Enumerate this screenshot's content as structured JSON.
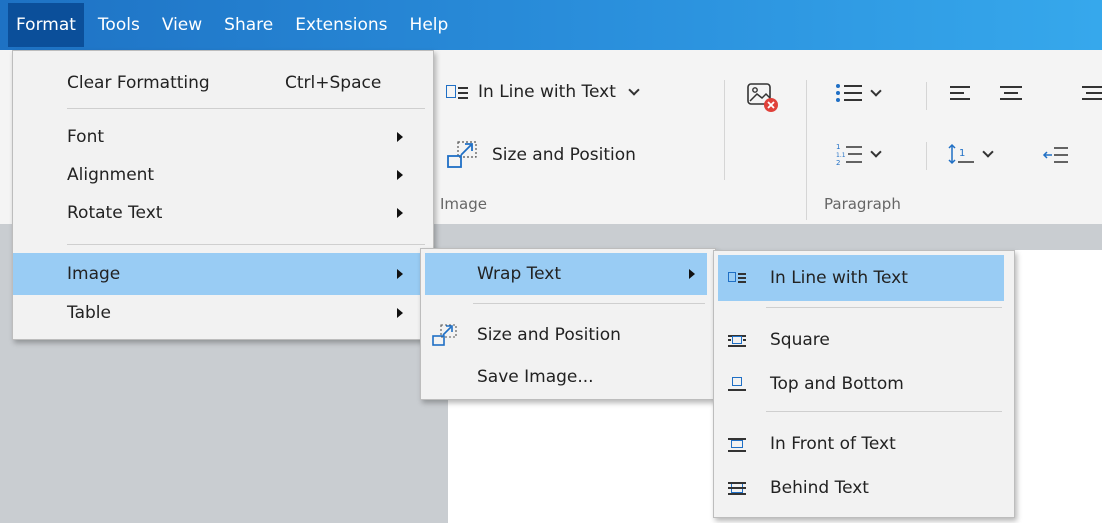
{
  "menubar": {
    "items": [
      "Format",
      "Tools",
      "View",
      "Share",
      "Extensions",
      "Help"
    ],
    "active": "Format"
  },
  "ribbon": {
    "wrap_label": "In Line with Text",
    "size_label": "Size and Position",
    "image_group": "Image",
    "paragraph_group": "Paragraph"
  },
  "format_menu": {
    "clear_formatting": "Clear Formatting",
    "clear_shortcut": "Ctrl+Space",
    "font": "Font",
    "alignment": "Alignment",
    "rotate_text": "Rotate Text",
    "image": "Image",
    "table": "Table"
  },
  "image_menu": {
    "wrap_text": "Wrap Text",
    "size_position": "Size and Position",
    "save_image": "Save Image..."
  },
  "wrap_menu": {
    "inline": "In Line with Text",
    "square": "Square",
    "top_bottom": "Top and Bottom",
    "in_front": "In Front of Text",
    "behind": "Behind Text"
  },
  "colors": {
    "menubar": "#2a8fdc",
    "highlight": "#99ccf4",
    "icon_blue": "#1f6fc5",
    "close_red": "#e0413a"
  }
}
